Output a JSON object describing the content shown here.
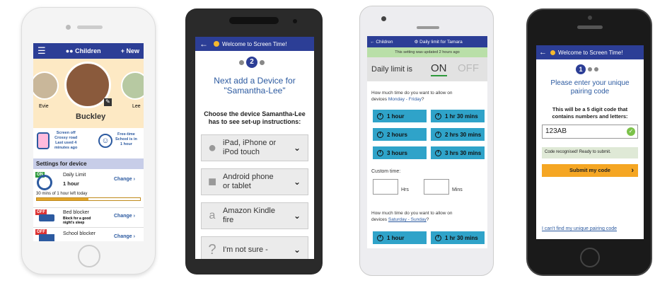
{
  "p1": {
    "title": "Children",
    "new_label": "+ New",
    "children": [
      "Evie",
      "Buckley",
      "Lee"
    ],
    "status_left": "Screen off\nCrossy road\nLast used 4\nminutes ago",
    "status_right": "Free-time\nSchool is in\n1 hour",
    "settings_header": "Settings for device",
    "daily": {
      "badge": "ON",
      "title": "Daily Limit",
      "value": "1 hour",
      "change": "Change",
      "progress_text": "30 mins of 1 hour left today",
      "progress": 0.5
    },
    "bed": {
      "badge": "OFF",
      "title": "Bed blocker",
      "desc": "Block for a good\nnight's sleep",
      "change": "Change"
    },
    "school": {
      "badge": "OFF",
      "title": "School blocker",
      "change": "Change"
    }
  },
  "p2": {
    "title": "Welcome to Screen Time!",
    "step": "2",
    "heading": "Next add a Device for\n\"Samantha-Lee\"",
    "sub": "Choose the device Samantha-Lee\nhas to see set-up instructions:",
    "devices": [
      {
        "icon": "apple-icon",
        "label": "iPad, iPhone or\niPod touch"
      },
      {
        "icon": "android-icon",
        "label": "Android phone\nor tablet"
      },
      {
        "icon": "amazon-icon",
        "label": "Amazon Kindle\nfire"
      },
      {
        "icon": "question-icon",
        "label": "I'm not sure -"
      }
    ]
  },
  "p3": {
    "back": "Children",
    "title": "Daily limit for Tamara",
    "updated": "This setting was updated 2 hours ago",
    "limit_label": "Daily limit is",
    "on": "ON",
    "off": "OFF",
    "q1": "How much time do you want to allow on\ndevices",
    "q1_days": "Monday - Friday",
    "opts1": [
      "1 hour",
      "1 hr 30 mins",
      "2 hours",
      "2 hrs 30 mins",
      "3 hours",
      "3 hrs 30 mins"
    ],
    "custom": "Custom time:",
    "hrs": "Hrs",
    "mins": "Mins",
    "q2": "How much time do you want to allow on\ndevices",
    "q2_days": "Saturday - Sunday",
    "opts2": [
      "1 hour",
      "1 hr 30 mins"
    ]
  },
  "p4": {
    "title": "Welcome to Screen Time!",
    "step": "1",
    "heading": "Please enter your unique\npairing code",
    "sub": "This will be a 5 digit code that\ncontains numbers and letters:",
    "code": "123AB",
    "ok": "Code recognised! Ready to submit.",
    "submit": "Submit my code",
    "link": "I can't find my unique pairing code"
  }
}
